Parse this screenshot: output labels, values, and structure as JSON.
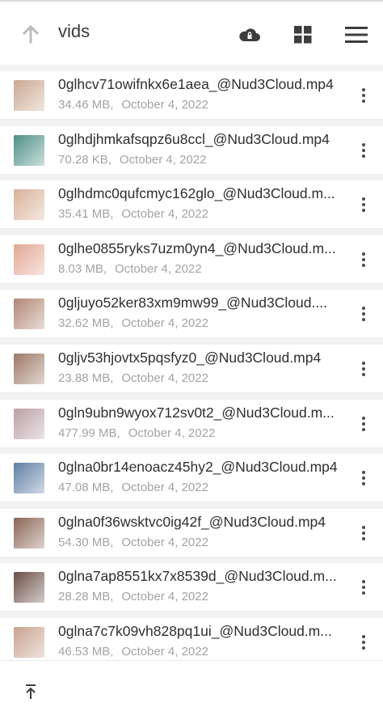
{
  "header": {
    "title": "vids"
  },
  "icons": {
    "up": "arrow-up-icon",
    "cloud": "cloud-lock-icon",
    "grid": "grid-view-icon",
    "menu": "hamburger-menu-icon",
    "more": "more-vertical-icon",
    "to_top": "scroll-to-top-icon"
  },
  "files": [
    {
      "name": "0glhcv71owifnkx6e1aea_@Nud3Cloud.mp4",
      "size": "34.46 MB,",
      "date": "October 4, 2022",
      "thumb": "#c9a892"
    },
    {
      "name": "0glhdjhmkafsqpz6u8ccl_@Nud3Cloud.mp4",
      "size": "70.28 KB,",
      "date": "October 4, 2022",
      "thumb": "#4e8f86"
    },
    {
      "name": "0glhdmc0qufcmyc162glo_@Nud3Cloud.m...",
      "size": "35.41 MB,",
      "date": "October 4, 2022",
      "thumb": "#d9b199"
    },
    {
      "name": "0glhe0855ryks7uzm0yn4_@Nud3Cloud.m...",
      "size": "8.03 MB,",
      "date": "October 4, 2022",
      "thumb": "#e2a793"
    },
    {
      "name": "0gljuyo52ker83xm9mw99_@Nud3Cloud....",
      "size": "32.62 MB,",
      "date": "October 4, 2022",
      "thumb": "#b08674"
    },
    {
      "name": "0gljv53hjovtx5pqsfyz0_@Nud3Cloud.mp4",
      "size": "23.88 MB,",
      "date": "October 4, 2022",
      "thumb": "#9c7864"
    },
    {
      "name": "0gln9ubn9wyox712sv0t2_@Nud3Cloud.m...",
      "size": "477.99 MB,",
      "date": "October 4, 2022",
      "thumb": "#b9a0a6"
    },
    {
      "name": "0glna0br14enoacz45hy2_@Nud3Cloud.mp4",
      "size": "47.08 MB,",
      "date": "October 4, 2022",
      "thumb": "#5e7fa3"
    },
    {
      "name": "0glna0f36wsktvc0ig42f_@Nud3Cloud.mp4",
      "size": "54.30 MB,",
      "date": "October 4, 2022",
      "thumb": "#8a6555"
    },
    {
      "name": "0glna7ap8551kx7x8539d_@Nud3Cloud.m...",
      "size": "28.28 MB,",
      "date": "October 4, 2022",
      "thumb": "#6a4f45"
    },
    {
      "name": "0glna7c7k09vh828pq1ui_@Nud3Cloud.m...",
      "size": "46.53 MB,",
      "date": "October 4, 2022",
      "thumb": "#c8a28e"
    }
  ]
}
